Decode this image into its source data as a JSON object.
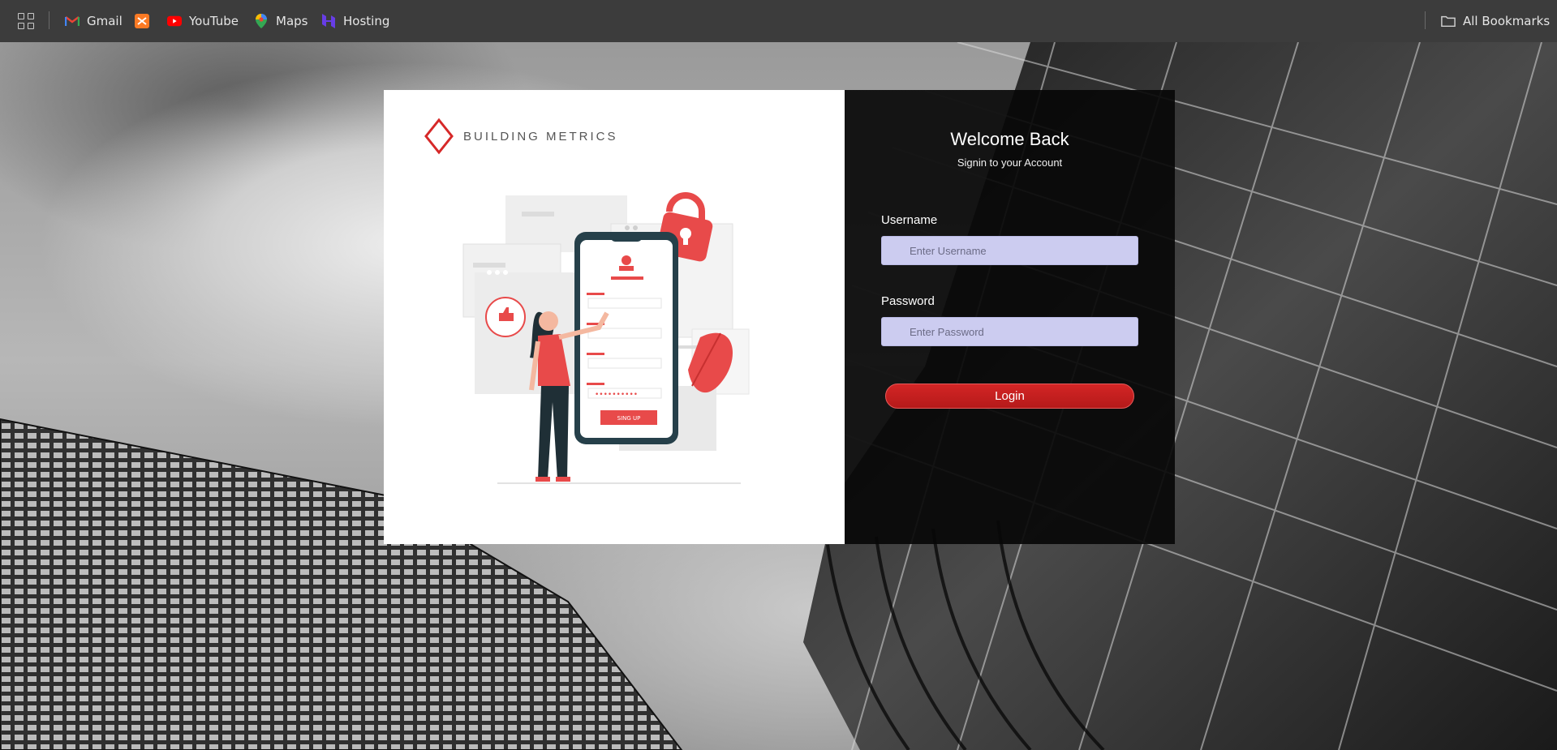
{
  "bookmarks": {
    "apps_icon": "apps-grid-icon",
    "items": [
      {
        "label": "Gmail",
        "icon": "gmail-icon"
      },
      {
        "label": "",
        "icon": "xampp-icon"
      },
      {
        "label": "YouTube",
        "icon": "youtube-icon"
      },
      {
        "label": "Maps",
        "icon": "maps-icon"
      },
      {
        "label": "Hosting",
        "icon": "hostinger-icon"
      }
    ],
    "all_bookmarks": "All Bookmarks"
  },
  "brand": {
    "name": "BUILDING METRICS",
    "accent_color": "#d62828"
  },
  "illustration": {
    "button_text": "SING UP"
  },
  "login": {
    "title": "Welcome Back",
    "subtitle": "Signin to your Account",
    "username_label": "Username",
    "username_placeholder": "Enter Username",
    "password_label": "Password",
    "password_placeholder": "Enter Password",
    "login_button": "Login"
  }
}
